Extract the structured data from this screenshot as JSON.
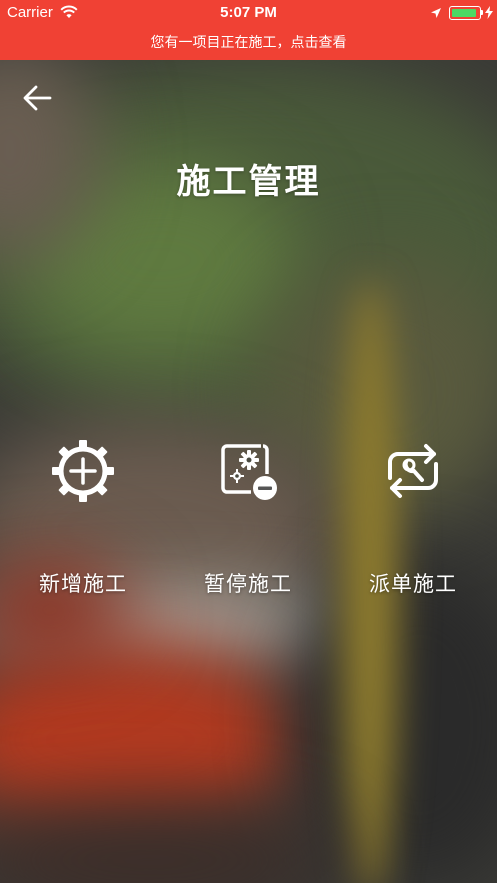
{
  "status_bar": {
    "carrier": "Carrier",
    "time": "5:07 PM",
    "icons": [
      "wifi-icon",
      "location-arrow-icon",
      "battery-icon",
      "charging-bolt-icon"
    ],
    "battery_color": "#4cd964"
  },
  "notice_banner": {
    "text": "您有一项目正在施工，点击查看",
    "background": "#f04134"
  },
  "header": {
    "back_icon": "back-arrow-icon",
    "title": "施工管理"
  },
  "actions": [
    {
      "label": "新增施工",
      "icon": "add-gear-icon"
    },
    {
      "label": "暂停施工",
      "icon": "pause-settings-icon"
    },
    {
      "label": "派单施工",
      "icon": "dispatch-wrench-icon"
    }
  ]
}
